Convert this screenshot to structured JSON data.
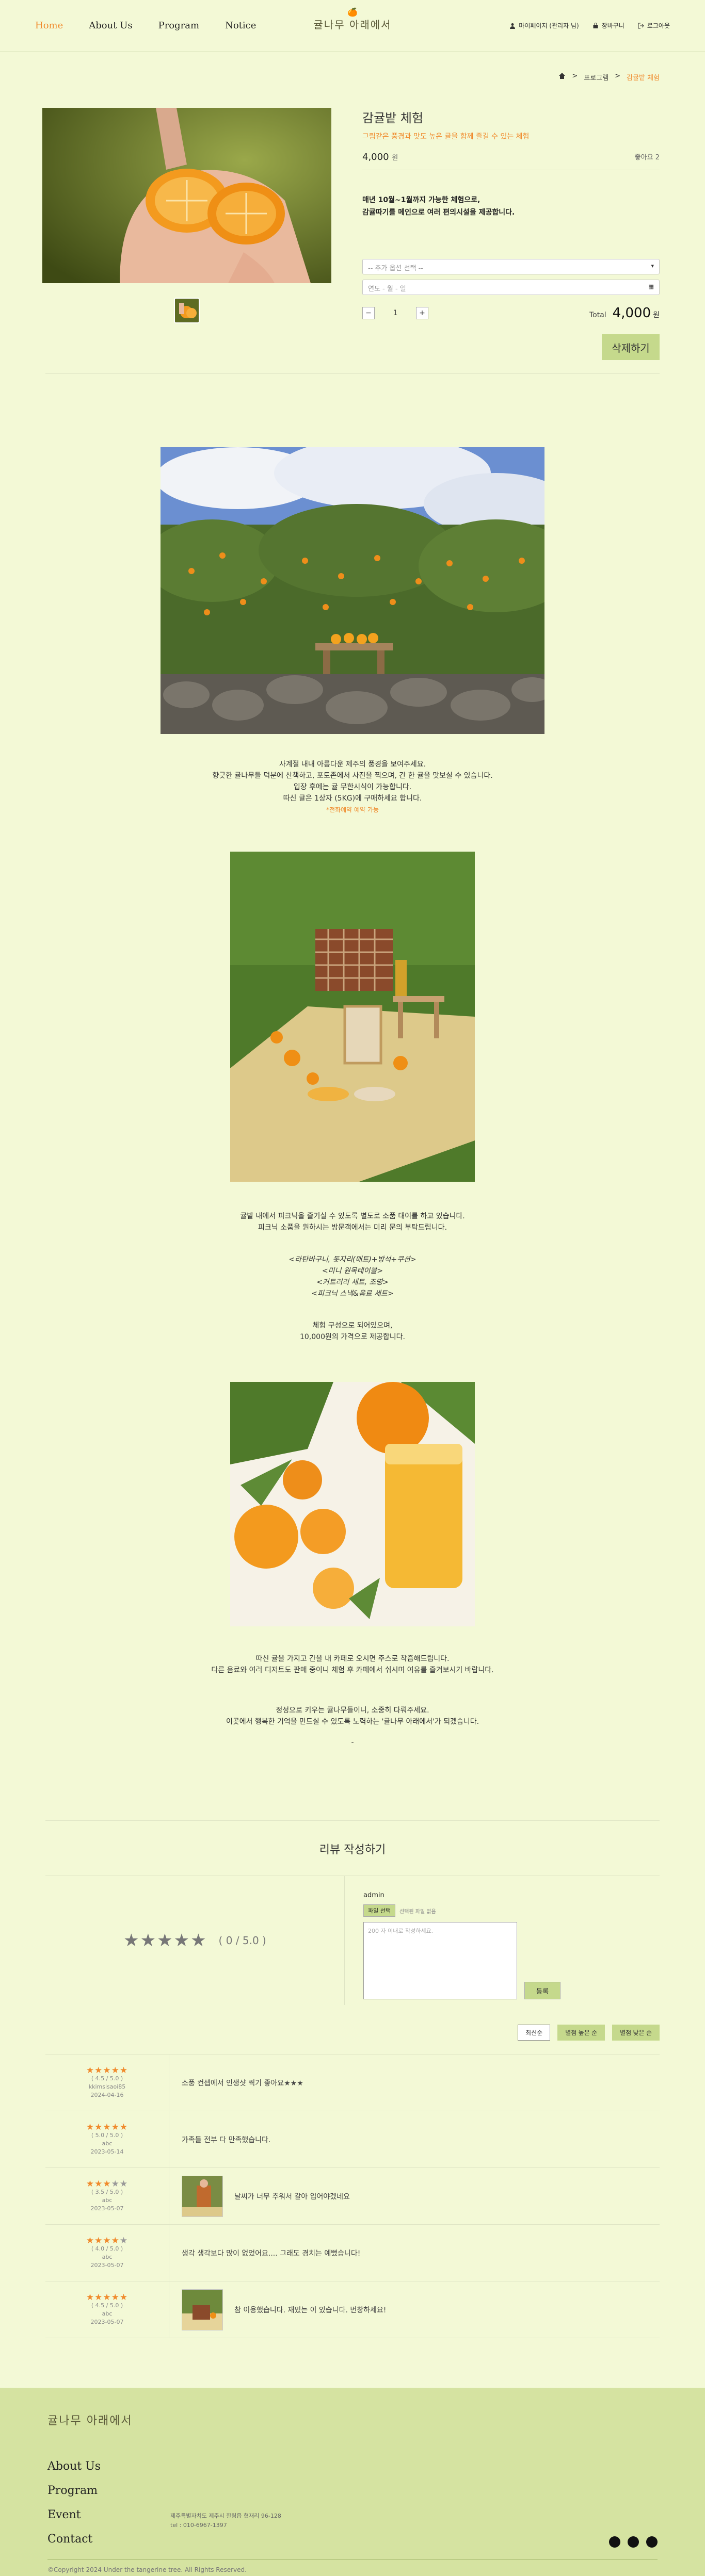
{
  "nav": {
    "home": "Home",
    "about": "About Us",
    "program": "Program",
    "notice": "Notice"
  },
  "logo": {
    "text": "귤나무 아래에서"
  },
  "header_right": {
    "mypage": "마이페이지 (관리자 님)",
    "cart": "장바구니",
    "logout": "로그아웃"
  },
  "breadcrumb": {
    "home_icon": "home-icon",
    "level1": "프로그램",
    "level2": "감귤밭 체험"
  },
  "product": {
    "title": "감귤밭 체험",
    "subtitle": "그림같은 풍경과 맛도 높은 귤을 함께 즐길 수 있는 체험",
    "price": "4,000",
    "price_unit": "원",
    "likes": "좋아요 2",
    "desc_line1": "매년 10월~1월까지 가능한 체험으로,",
    "desc_line2": "감귤따기를 메인으로 여러 편의시설을 제공합니다.",
    "option_placeholder": "-- 추가 옵션 선택 --",
    "date_placeholder": "연도 - 월 - 일",
    "qty": "1",
    "total_label": "Total",
    "total_value": "4,000",
    "total_unit": "원",
    "delete_button": "삭제하기"
  },
  "story": {
    "para1_line1": "사계절 내내 아름다운 제주의 풍경을 보여주세요.",
    "para1_line2": "향긋한 귤나무들 덕분에 산책하고, 포토존에서 사진을 찍으며, 간 한 귤을 맛보실 수 있습니다.",
    "para1_line3": "입장 후에는 귤 무한시식이 가능합니다.",
    "para1_line4": "따신 귤은 1상자 (5KG)에 구매하세요 합니다.",
    "para1_note": "*전화예약 예약 가능",
    "para2_line1": "귤밭 내에서 피크닉을 즐기실 수 있도록 별도로 소품 대여를 하고 있습니다.",
    "para2_line2": "피크닉 소품을 원하시는 방문객에서는 미리 문의 부탁드립니다.",
    "set1": "<라탄바구니, 돗자리(매트)+방석+쿠션>",
    "set2": "<미니 원목테이블>",
    "set3": "<커트러리 세트, 조명>",
    "set4": "<피크닉 스낵&음료 세트>",
    "para3_line1": "체험 구성으로 되어있으며,",
    "para3_line2": "10,000원의 가격으로 제공합니다.",
    "para4_line1": "따신 귤을 가지고 간을 내 카페로 오시면 주스로 착즙해드립니다.",
    "para4_line2": "다른 음료와 여러 디저트도 판매 중이니 체험 후 카페에서 쉬시며 여유를 즐겨보시기 바랍니다.",
    "para5_line1": "정성으로 키우는 귤나무들이니, 소중히 다뤄주세요.",
    "para5_line2": "이곳에서 행복한 기억을 만드실 수 있도록 노력하는 '귤나무 아래에서'가 되겠습니다.",
    "dash": "-"
  },
  "review_form": {
    "title": "리뷰 작성하기",
    "stars": "★★★★★",
    "score": "( 0 / 5.0 )",
    "user": "admin",
    "file_button": "파일 선택",
    "file_status": "선택된 파일 없음",
    "textarea_placeholder": "200 자 이내로 작성하세요.",
    "submit": "등록"
  },
  "sort": {
    "latest": "최신순",
    "high": "별점 높은 순",
    "low": "별점 낮은 순"
  },
  "reviews": [
    {
      "full": 5,
      "empty": 0,
      "score": "( 4.5 / 5.0 )",
      "user": "kkimsisaoi85",
      "date": "2024-04-16",
      "text": "소풍 컨셉에서 인생샷 찍기 좋아요★★★",
      "has_img": false
    },
    {
      "full": 5,
      "empty": 0,
      "score": "( 5.0 / 5.0 )",
      "user": "abc",
      "date": "2023-05-14",
      "text": "가족들 전부 다 만족했습니다.",
      "has_img": false
    },
    {
      "full": 3,
      "empty": 2,
      "score": "( 3.5 / 5.0 )",
      "user": "abc",
      "date": "2023-05-07",
      "text": "날씨가 너무 추워서 갈아 입어야겠네요",
      "has_img": true
    },
    {
      "full": 4,
      "empty": 1,
      "score": "( 4.0 / 5.0 )",
      "user": "abc",
      "date": "2023-05-07",
      "text": "생각 생각보다 많이 없었어요.... 그래도 경치는 예뻤습니다!",
      "has_img": false
    },
    {
      "full": 5,
      "empty": 0,
      "score": "( 4.5 / 5.0 )",
      "user": "abc",
      "date": "2023-05-07",
      "text": "참 이용했습니다. 재밌는 이 있습니다. 번창하세요!",
      "has_img": true
    }
  ],
  "footer": {
    "logo": "귤나무 아래에서",
    "links": [
      "About Us",
      "Program",
      "Event",
      "Contact"
    ],
    "address": "제주특별자치도 제주시 한림읍 협재리 96-128",
    "tel": "tel : 010-6967-1397",
    "copyright": "©Copyright 2024 Under the tangerine tree. All Rights Reserved."
  },
  "colors": {
    "background": "#f3f9d6",
    "accent": "#f08a2c",
    "button": "#c5d98c",
    "footer": "#d5e3a1"
  }
}
